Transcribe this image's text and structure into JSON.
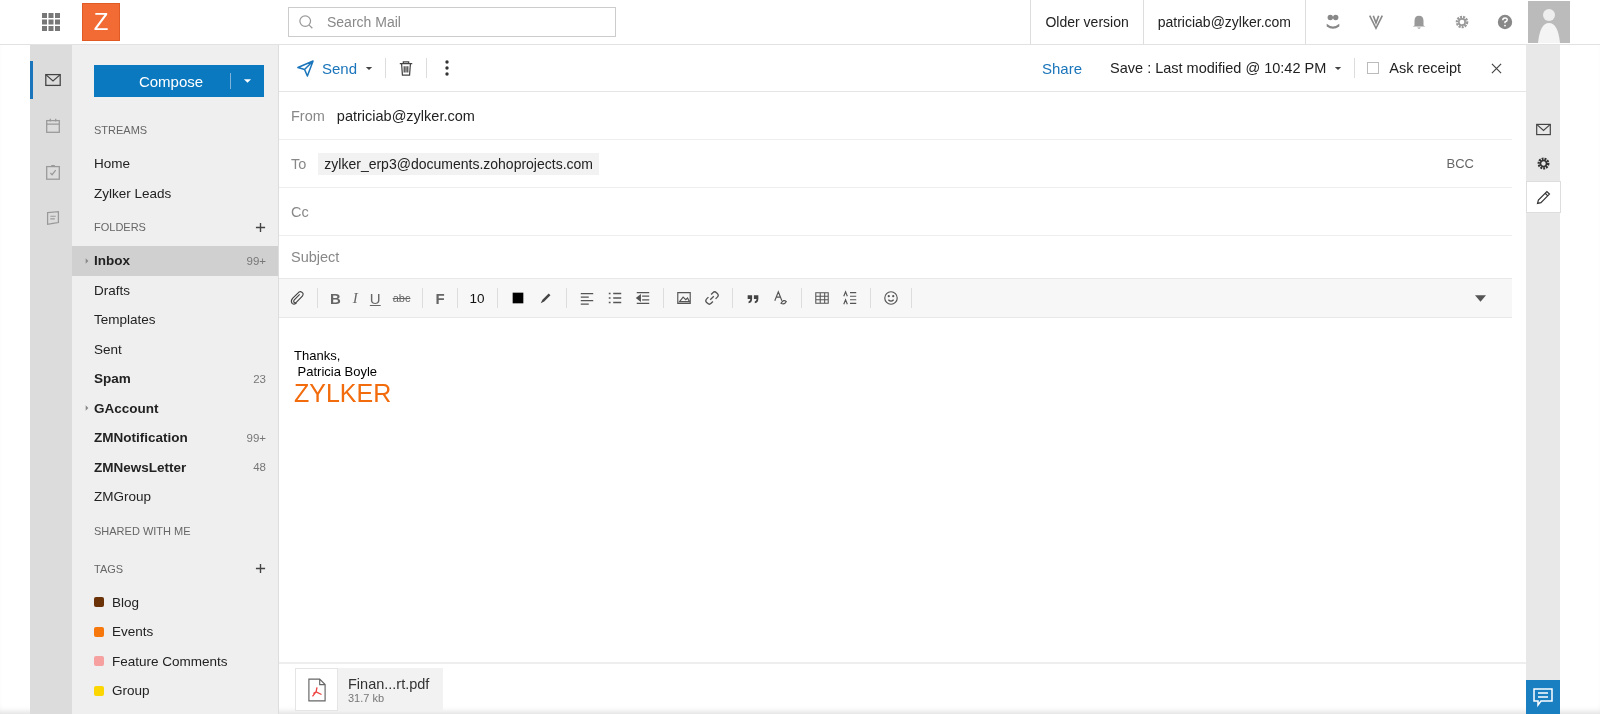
{
  "top_bar": {
    "logo": "Z",
    "search": {
      "placeholder": "Search Mail"
    },
    "links": [
      "Older version",
      "patriciab@zylker.com"
    ]
  },
  "app_rail": [
    {
      "kind": "mail",
      "selected": true
    },
    {
      "kind": "calendar",
      "selected": false
    },
    {
      "kind": "tasks",
      "selected": false
    },
    {
      "kind": "notes",
      "selected": false
    }
  ],
  "sidebar": {
    "compose": "Compose",
    "sections": [
      {
        "title": "STREAMS",
        "addable": false,
        "items": [
          {
            "label": "Home",
            "bold": false,
            "selected": false,
            "expandable": false
          },
          {
            "label": "Zylker Leads",
            "bold": false,
            "selected": false,
            "expandable": false
          }
        ]
      },
      {
        "title": "FOLDERS",
        "addable": true,
        "items": [
          {
            "label": "Inbox",
            "count": "99+",
            "bold": true,
            "selected": true,
            "expandable": true
          },
          {
            "label": "Drafts",
            "bold": false,
            "selected": false,
            "expandable": false
          },
          {
            "label": "Templates",
            "bold": false,
            "selected": false,
            "expandable": false
          },
          {
            "label": "Sent",
            "bold": false,
            "selected": false,
            "expandable": false
          },
          {
            "label": "Spam",
            "count": "23",
            "bold": true,
            "selected": false,
            "expandable": false
          },
          {
            "label": "GAccount",
            "bold": true,
            "selected": false,
            "expandable": true
          },
          {
            "label": "ZMNotification",
            "count": "99+",
            "bold": true,
            "selected": false,
            "expandable": false
          },
          {
            "label": "ZMNewsLetter",
            "count": "48",
            "bold": true,
            "selected": false,
            "expandable": false
          },
          {
            "label": "ZMGroup",
            "bold": false,
            "selected": false,
            "expandable": false
          }
        ]
      },
      {
        "title": "SHARED WITH ME",
        "addable": false
      },
      {
        "title": "TAGS",
        "addable": true,
        "items": [
          {
            "label": "Blog",
            "color": "#6b3208",
            "bold": false,
            "selected": false,
            "expandable": false
          },
          {
            "label": "Events",
            "color": "#f6780c",
            "bold": false,
            "selected": false,
            "expandable": false
          },
          {
            "label": "Feature Comments",
            "color": "#f7a0a0",
            "bold": false,
            "selected": false,
            "expandable": false
          },
          {
            "label": "Group",
            "color": "#fbd600",
            "bold": false,
            "selected": false,
            "expandable": false
          }
        ]
      }
    ]
  },
  "composer": {
    "send": "Send",
    "share": "Share",
    "save": "Save : Last modified @ 10:42 PM",
    "ask_receipt": {
      "label": "Ask receipt",
      "checked": false
    },
    "from": {
      "label": "From",
      "value": "patriciab@zylker.com"
    },
    "to": {
      "label": "To",
      "recipients": [
        "zylker_erp3@documents.zohoprojects.com"
      ],
      "bcc": "BCC"
    },
    "cc": {
      "label": "Cc"
    },
    "subject": {
      "placeholder": "Subject"
    },
    "toolbar": [
      {
        "kind": "attach"
      },
      {
        "kind": "sep"
      },
      {
        "kind": "bold",
        "glyph": "B"
      },
      {
        "kind": "italic",
        "glyph": "I"
      },
      {
        "kind": "underline",
        "glyph": "U"
      },
      {
        "kind": "strike",
        "glyph": "abc"
      },
      {
        "kind": "sep"
      },
      {
        "kind": "font",
        "glyph": "F"
      },
      {
        "kind": "sep"
      },
      {
        "kind": "size",
        "glyph": "10"
      },
      {
        "kind": "sep"
      },
      {
        "kind": "color"
      },
      {
        "kind": "highlight"
      },
      {
        "kind": "sep"
      },
      {
        "kind": "align"
      },
      {
        "kind": "list"
      },
      {
        "kind": "outdent"
      },
      {
        "kind": "sep"
      },
      {
        "kind": "image"
      },
      {
        "kind": "link"
      },
      {
        "kind": "sep"
      },
      {
        "kind": "quote"
      },
      {
        "kind": "clear"
      },
      {
        "kind": "sep"
      },
      {
        "kind": "table"
      },
      {
        "kind": "spacing"
      },
      {
        "kind": "sep"
      },
      {
        "kind": "emoji"
      },
      {
        "kind": "sep"
      }
    ],
    "body": {
      "lines": [
        "Thanks,",
        " Patricia Boyle"
      ],
      "signature_logo": "ZYLKER"
    },
    "attachments": [
      {
        "name": "Finan...rt.pdf",
        "size": "31.7 kb"
      }
    ]
  },
  "side_rail": [
    {
      "kind": "mail",
      "selected": false
    },
    {
      "kind": "settings",
      "selected": false
    },
    {
      "kind": "edit",
      "selected": true
    }
  ]
}
